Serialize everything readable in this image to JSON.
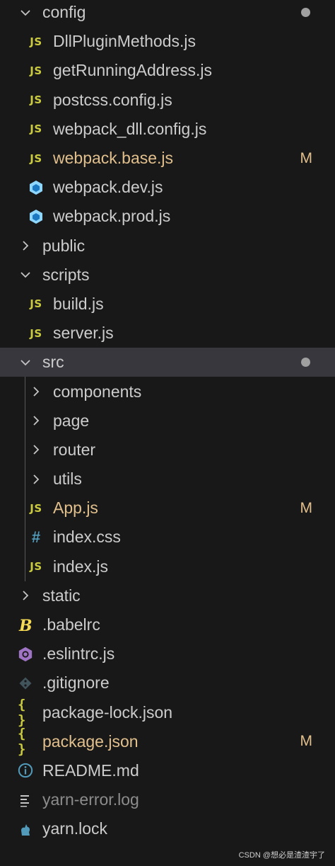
{
  "explorer": {
    "items": [
      {
        "name": "config",
        "kind": "folder-open",
        "depth": 0,
        "dot": true
      },
      {
        "name": "DllPluginMethods.js",
        "kind": "js",
        "depth": 1
      },
      {
        "name": "getRunningAddress.js",
        "kind": "js",
        "depth": 1
      },
      {
        "name": "postcss.config.js",
        "kind": "js",
        "depth": 1
      },
      {
        "name": "webpack_dll.config.js",
        "kind": "js",
        "depth": 1
      },
      {
        "name": "webpack.base.js",
        "kind": "js",
        "depth": 1,
        "status": "M"
      },
      {
        "name": "webpack.dev.js",
        "kind": "webpack",
        "depth": 1
      },
      {
        "name": "webpack.prod.js",
        "kind": "webpack",
        "depth": 1
      },
      {
        "name": "public",
        "kind": "folder-closed",
        "depth": 0
      },
      {
        "name": "scripts",
        "kind": "folder-open",
        "depth": 0
      },
      {
        "name": "build.js",
        "kind": "js",
        "depth": 1
      },
      {
        "name": "server.js",
        "kind": "js",
        "depth": 1
      },
      {
        "name": "src",
        "kind": "folder-open",
        "depth": 0,
        "dot": true,
        "selected": true
      },
      {
        "name": "components",
        "kind": "folder-closed",
        "depth": 1
      },
      {
        "name": "page",
        "kind": "folder-closed",
        "depth": 1
      },
      {
        "name": "router",
        "kind": "folder-closed",
        "depth": 1
      },
      {
        "name": "utils",
        "kind": "folder-closed",
        "depth": 1
      },
      {
        "name": "App.js",
        "kind": "js",
        "depth": 1,
        "status": "M"
      },
      {
        "name": "index.css",
        "kind": "css",
        "depth": 1
      },
      {
        "name": "index.js",
        "kind": "js",
        "depth": 1
      },
      {
        "name": "static",
        "kind": "folder-closed",
        "depth": 0
      },
      {
        "name": ".babelrc",
        "kind": "babel",
        "depth": 0
      },
      {
        "name": ".eslintrc.js",
        "kind": "eslint",
        "depth": 0
      },
      {
        "name": ".gitignore",
        "kind": "git",
        "depth": 0
      },
      {
        "name": "package-lock.json",
        "kind": "json",
        "depth": 0
      },
      {
        "name": "package.json",
        "kind": "json",
        "depth": 0,
        "status": "M"
      },
      {
        "name": "README.md",
        "kind": "info",
        "depth": 0
      },
      {
        "name": "yarn-error.log",
        "kind": "log",
        "depth": 0,
        "ignored": true
      },
      {
        "name": "yarn.lock",
        "kind": "yarn",
        "depth": 0
      }
    ]
  },
  "icons": {
    "js_badge": "JS",
    "css_badge": "#",
    "json_badge": "{ }"
  },
  "watermark": "CSDN @想必是渣渣宇了",
  "colors": {
    "background": "#181818",
    "selected": "#37373d",
    "modified": "#e2c08d",
    "js": "#cbcb41",
    "webpack": "#519aba",
    "eslint": "#a074c4"
  }
}
